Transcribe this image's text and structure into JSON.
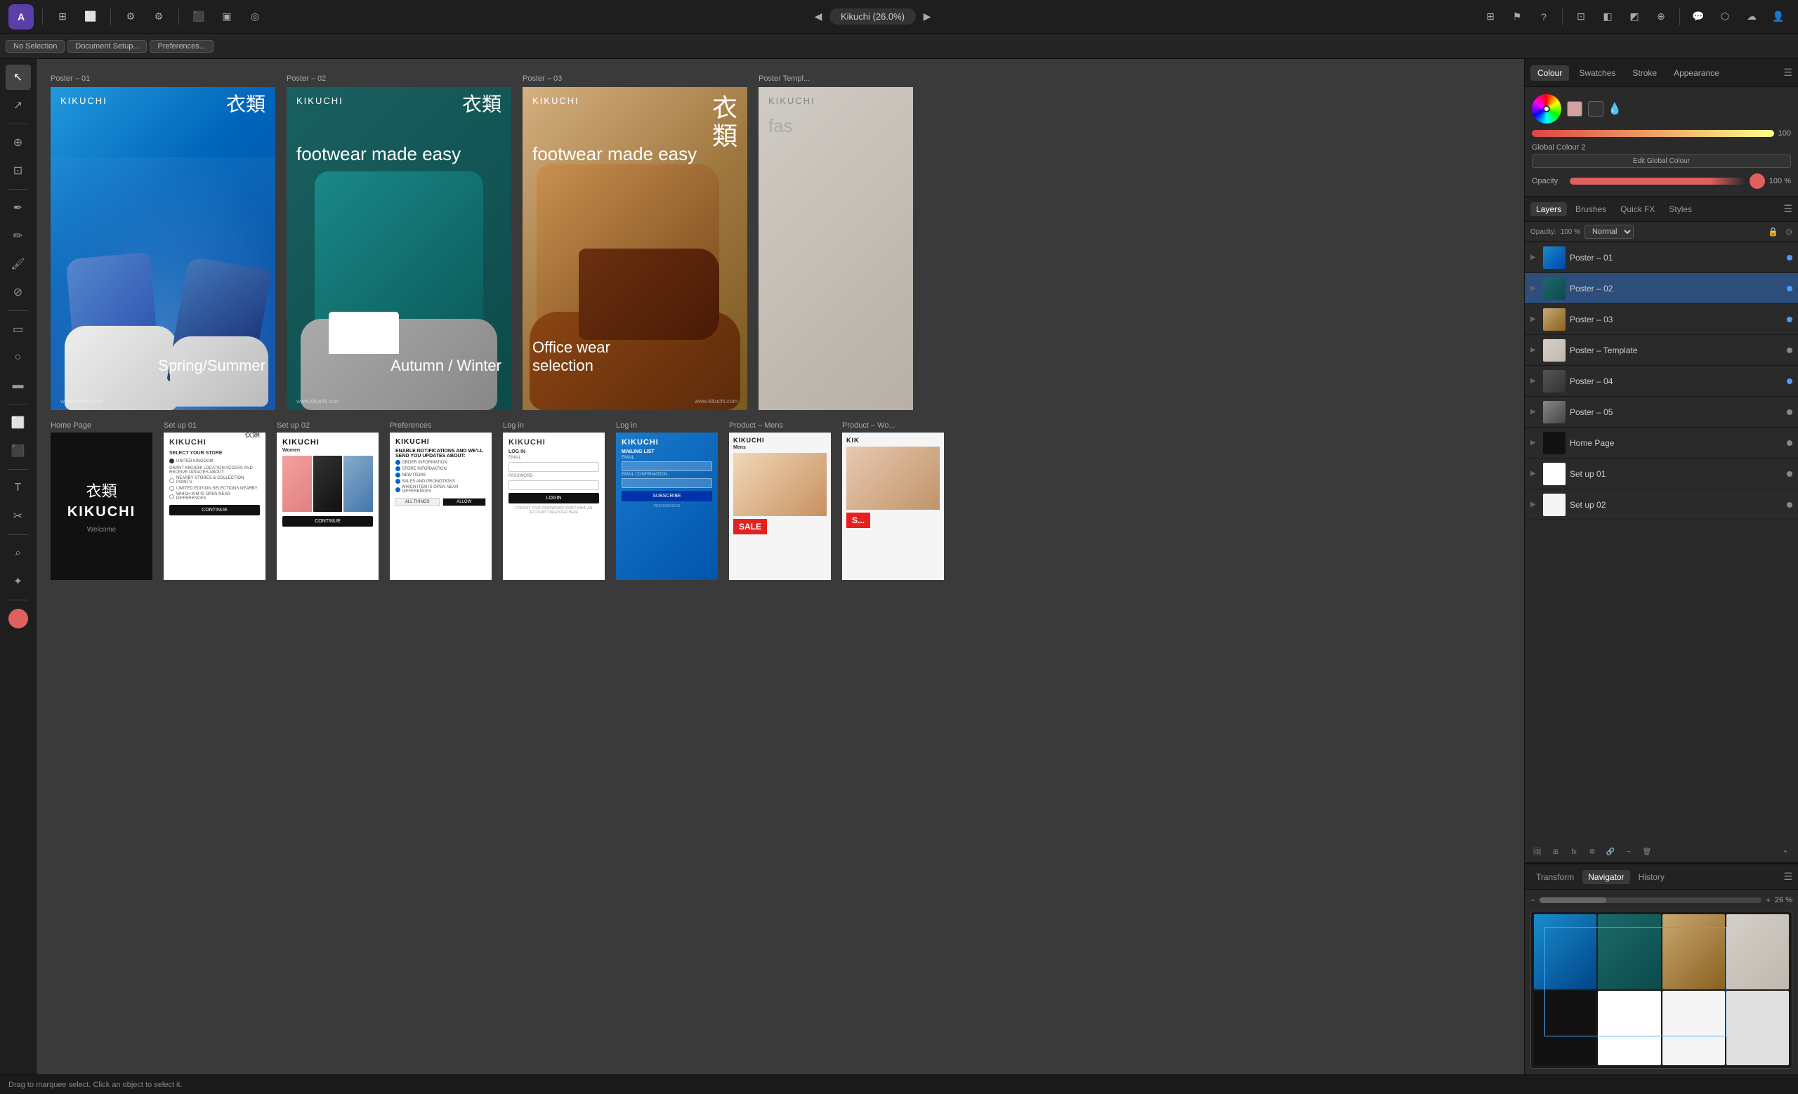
{
  "app": {
    "title": "Kikuchi (26.0%)",
    "logo": "A",
    "logo_bg": "#5b3fa8"
  },
  "toolbar": {
    "no_selection": "No Selection",
    "document_setup": "Document Setup...",
    "preferences": "Preferences..."
  },
  "status_bar": {
    "message": "Drag to marquee select. Click an object to select it."
  },
  "canvas": {
    "poster_row": [
      {
        "label": "Poster – 01",
        "type": "poster01"
      },
      {
        "label": "Poster – 02",
        "type": "poster02"
      },
      {
        "label": "Poster – 03",
        "type": "poster03"
      },
      {
        "label": "Poster Templ...",
        "type": "poster_template"
      }
    ],
    "page_row": [
      {
        "label": "Home Page",
        "type": "home"
      },
      {
        "label": "Set up 01",
        "type": "setup01"
      },
      {
        "label": "Set up 02",
        "type": "setup02"
      },
      {
        "label": "Preferences",
        "type": "prefs"
      },
      {
        "label": "Log in",
        "type": "login"
      },
      {
        "label": "Log in",
        "type": "login2"
      },
      {
        "label": "Product – Mens",
        "type": "product"
      },
      {
        "label": "Product – Wo...",
        "type": "product2"
      }
    ]
  },
  "right_panel": {
    "colour_tab": "Colour",
    "swatches_tab": "Swatches",
    "stroke_tab": "Stroke",
    "appearance_tab": "Appearance",
    "global_colour_2": "Global Colour 2",
    "edit_global_colour": "Edit Global Colour",
    "opacity_label": "Opacity",
    "opacity_value": "100 %",
    "colour_value": "100",
    "layers_tab": "Layers",
    "brushes_tab": "Brushes",
    "quickfx_tab": "Quick FX",
    "styles_tab": "Styles",
    "blend_mode": "Normal",
    "opacity_mini": "100 %",
    "layers": [
      {
        "name": "Poster – 01",
        "thumb": "01",
        "dot": true
      },
      {
        "name": "Poster – 02",
        "thumb": "02",
        "dot": true,
        "selected": true
      },
      {
        "name": "Poster – 03",
        "thumb": "03",
        "dot": true
      },
      {
        "name": "Poster – Template",
        "thumb": "tpl",
        "dot": false
      },
      {
        "name": "Poster – 04",
        "thumb": "04",
        "dot": true
      },
      {
        "name": "Poster – 05",
        "thumb": "05",
        "dot": false
      },
      {
        "name": "Home Page",
        "thumb": "hp",
        "dot": false
      },
      {
        "name": "Set up 01",
        "thumb": "s1",
        "dot": false
      },
      {
        "name": "Set up 02",
        "thumb": "s2",
        "dot": false
      }
    ],
    "transform_tab": "Transform",
    "navigator_tab": "Navigator",
    "history_tab": "History",
    "zoom_value": "26 %"
  },
  "posters": {
    "brand": "KIKUCHI",
    "kanji_01": "衣類",
    "kanji_02": "衣\n類",
    "tagline_1": "footwear made easy",
    "tagline_2": "footwear made easy",
    "tagline_3": "fas...",
    "season_01": "Spring/Summer",
    "season_02": "Autumn / Winter",
    "season_03": "Office wear\nselection",
    "website": "www.kikuchi.com"
  },
  "icons": {
    "menu": "☰",
    "plus": "+",
    "minus": "−",
    "lock": "🔒",
    "eye": "👁",
    "trash": "🗑",
    "settings": "⚙",
    "expand": "▶",
    "collapse": "▼",
    "layers": "◧",
    "brush": "✏",
    "fx": "fx",
    "styles": "◈",
    "cursor": "↖",
    "pen": "✒",
    "shape": "▭",
    "text": "T",
    "zoom": "⌕",
    "fill": "◉",
    "color_picker": "✦",
    "gradient": "⬜",
    "crop": "⊡",
    "move": "✛",
    "select": "◻",
    "node": "◆",
    "knife": "✂",
    "fill_tool": "⬛",
    "spray": "⊕",
    "blend_tool": "⊚",
    "color_swatch": "⬡",
    "dropper": "💧"
  }
}
